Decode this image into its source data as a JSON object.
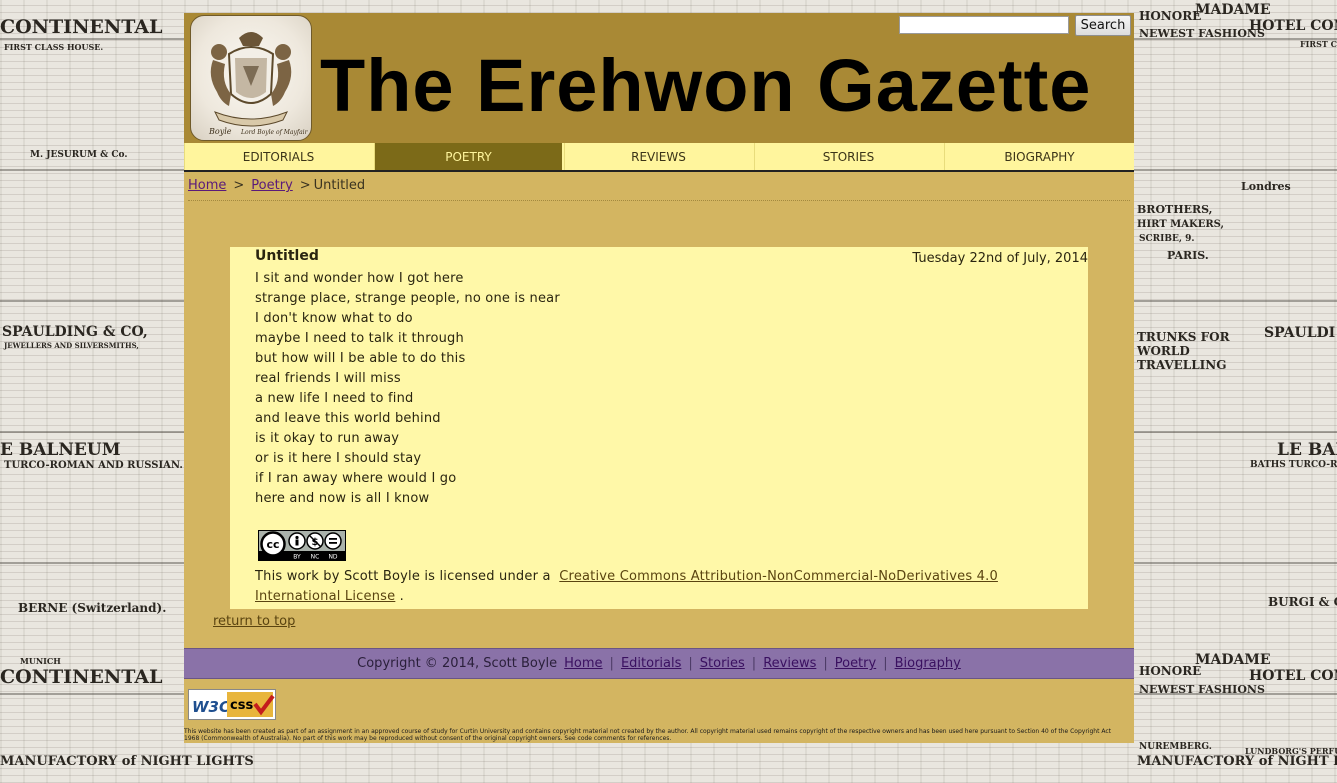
{
  "search": {
    "placeholder": "",
    "button_label": "Search"
  },
  "header": {
    "site_title": "The Erehwon Gazette",
    "logo_text": "Boyle Lord Boyle of Mayfair"
  },
  "nav": {
    "items": [
      {
        "label": "Editorials",
        "active": false
      },
      {
        "label": "Poetry",
        "active": true
      },
      {
        "label": "Reviews",
        "active": false
      },
      {
        "label": "Stories",
        "active": false
      },
      {
        "label": "Biography",
        "active": false
      }
    ]
  },
  "breadcrumb": {
    "home": "Home",
    "section": "Poetry",
    "current": "Untitled",
    "separator": ">"
  },
  "article": {
    "title": "Untitled",
    "date": "Tuesday 22nd of July, 2014",
    "lines": [
      "I sit and wonder how I got here",
      "strange place, strange people, no one is near",
      "I don't know what to do",
      "maybe I need to talk it through",
      "but how will I be able to do this",
      "real friends I will miss",
      "a new life I need to find",
      "and leave this world behind",
      "is it okay to run away",
      "or is it here I should stay",
      "if I ran away where would I go",
      "here and now is all I know"
    ],
    "license_prefix": "This work by Scott Boyle is licensed under a",
    "license_link": "Creative Commons Attribution-NonCommercial-NoDerivatives 4.0 International License",
    "license_suffix": ".",
    "cc_labels": {
      "by": "BY",
      "nc": "NC",
      "nd": "ND"
    }
  },
  "return_top": "return to top",
  "footer": {
    "copyright": "Copyright © 2014, Scott Boyle",
    "links": [
      "Home",
      "Editorials",
      "Stories",
      "Reviews",
      "Poetry",
      "Biography"
    ],
    "separator": "|"
  },
  "w3c_badge": {
    "w3c": "W3C",
    "css": "css"
  },
  "disclaimer": "This website has been created as part of an assignment in an approved course of study for Curtin University and contains copyright material not created by the author. All copyright material used remains copyright of the respective owners and has been used here pursuant to Section 40 of the Copyright Act 1968 (Commonwealth of Australia). No part of this work may be reproduced without consent of the original copyright owners. See code comments for references.",
  "background_newsprint": [
    "CONTINENTAL",
    "FIRST CLASS HOUSE.",
    "MADAME",
    "HONORE",
    "NEWEST FASHIONS",
    "HOTEL CON",
    "FIRST CL",
    "M. JESURUM & Co.",
    "Londres",
    "BROTHERS,",
    "HIRT MAKERS,",
    "SCRIBE, 9.",
    "PARIS.",
    "SPAULDING & CO,",
    "JEWELLERS AND SILVERSMITHS,",
    "SPAULDI",
    "TRUNKS FOR WORLD TRAVELLING",
    "E BALNEUM",
    "TURCO-ROMAN AND RUSSIAN.",
    "LE BAL",
    "BATHS TURCO-R",
    "BERNE (Switzerland).",
    "MANUFACTORY of NIGHT LIGHTS",
    "BURGI & C",
    "MUNICH",
    "NUREMBERG.",
    "LUNDBORG'S PERFUMES"
  ],
  "colors": {
    "page_bg": "#d3b561",
    "header_bg": "#a98935",
    "nav_bg": "#fff59d",
    "nav_active_bg": "#7c6a18",
    "article_bg": "#fff8a8",
    "footer_bg": "#8a72a8",
    "link": "#5a1a7a"
  }
}
